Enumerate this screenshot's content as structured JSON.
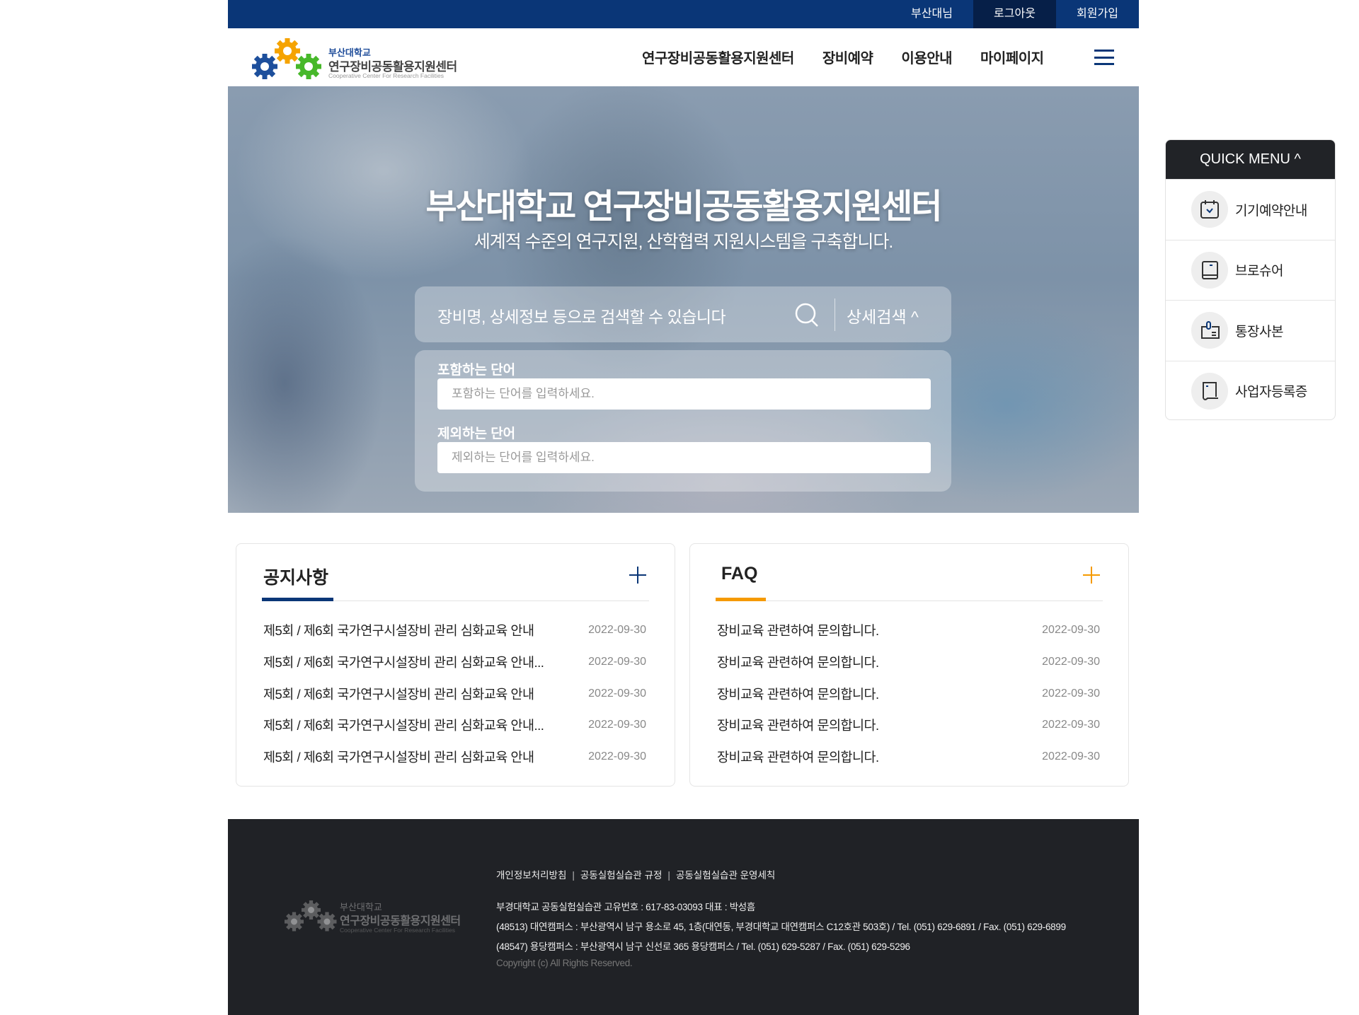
{
  "topbar": {
    "links": [
      "부산대님",
      "로그아웃",
      "회원가입"
    ]
  },
  "header": {
    "logo": {
      "line1": "부산대학교",
      "line2": "연구장비공동활용지원센터",
      "line3": "Cooperative Center For Research Facilities"
    },
    "nav": [
      "연구장비공동활용지원센터",
      "장비예약",
      "이용안내",
      "마이페이지"
    ]
  },
  "hero": {
    "title": "부산대학교 연구장비공동활용지원센터",
    "subtitle": "세계적 수준의 연구지원, 산학협력 지원시스템을 구축합니다.",
    "search_placeholder": "장비명, 상세정보 등으로 검색할 수 있습니다",
    "advanced_label": "상세검색 ^",
    "include_label": "포함하는 단어",
    "include_placeholder": "포함하는 단어를 입력하세요.",
    "exclude_label": "제외하는 단어",
    "exclude_placeholder": "제외하는 단어를 입력하세요."
  },
  "notice": {
    "title": "공지사항",
    "accent": "#0a3677",
    "items": [
      {
        "title": "제5회 / 제6회 국가연구시설장비 관리 심화교육 안내",
        "date": "2022-09-30"
      },
      {
        "title": "제5회 / 제6회 국가연구시설장비 관리 심화교육 안내...",
        "date": "2022-09-30"
      },
      {
        "title": "제5회 / 제6회 국가연구시설장비 관리 심화교육 안내",
        "date": "2022-09-30"
      },
      {
        "title": "제5회 / 제6회 국가연구시설장비 관리 심화교육 안내...",
        "date": "2022-09-30"
      },
      {
        "title": "제5회 / 제6회 국가연구시설장비 관리 심화교육 안내",
        "date": "2022-09-30"
      }
    ]
  },
  "faq": {
    "title": "FAQ",
    "accent": "#f59a00",
    "items": [
      {
        "title": "장비교육 관련하여 문의합니다.",
        "date": "2022-09-30"
      },
      {
        "title": "장비교육 관련하여 문의합니다.",
        "date": "2022-09-30"
      },
      {
        "title": "장비교육 관련하여 문의합니다.",
        "date": "2022-09-30"
      },
      {
        "title": "장비교육 관련하여 문의합니다.",
        "date": "2022-09-30"
      },
      {
        "title": "장비교육 관련하여 문의합니다.",
        "date": "2022-09-30"
      }
    ]
  },
  "quick": {
    "title": "QUICK MENU ^",
    "items": [
      {
        "label": "기기예약안내",
        "icon": "calendar-check-icon"
      },
      {
        "label": "브로슈어",
        "icon": "book-icon"
      },
      {
        "label": "통장사본",
        "icon": "bankbook-icon"
      },
      {
        "label": "사업자등록증",
        "icon": "certificate-icon"
      }
    ]
  },
  "footer": {
    "logo": {
      "line1": "부산대학교",
      "line2": "연구장비공동활용지원센터",
      "line3": "Cooperative Center For Research Facilities"
    },
    "links": [
      "개인정보처리방침",
      "공동실험실습관 규정",
      "공동실험실습관 운영세칙"
    ],
    "info": [
      "부경대학교 공동실험실습관 고유번호 : 617-83-03093 대표 : 박성흠",
      "(48513) 대연캠퍼스 : 부산광역시 남구 용소로 45, 1층(대연동, 부경대학교 대연캠퍼스 C12호관 503호) / Tel. (051) 629-6891 / Fax. (051) 629-6899",
      "(48547) 용당캠퍼스 : 부산광역시 남구 신선로 365 용당캠퍼스 / Tel. (051) 629-5287 / Fax. (051) 629-5296"
    ],
    "copyright": "Copyright (c) All Rights Reserved."
  }
}
